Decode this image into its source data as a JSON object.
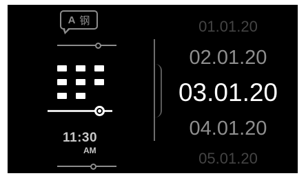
{
  "language": {
    "latin_letter": "A",
    "cjk_char": "钢",
    "slider_value": 0.68
  },
  "grid": {
    "slider_value": 0.81
  },
  "time": {
    "hours_minutes": "11:30",
    "ampm": "AM",
    "slider_value": 0.6
  },
  "dates": {
    "items": [
      "01.01.20",
      "02.01.20",
      "03.01.20",
      "04.01.20",
      "05.01.20"
    ],
    "selected_index": 2
  },
  "colors": {
    "background": "#000000",
    "selected": "#ffffff",
    "near": "#8e8e8e",
    "far": "#444444",
    "icon_gray": "#8d8d8d"
  }
}
